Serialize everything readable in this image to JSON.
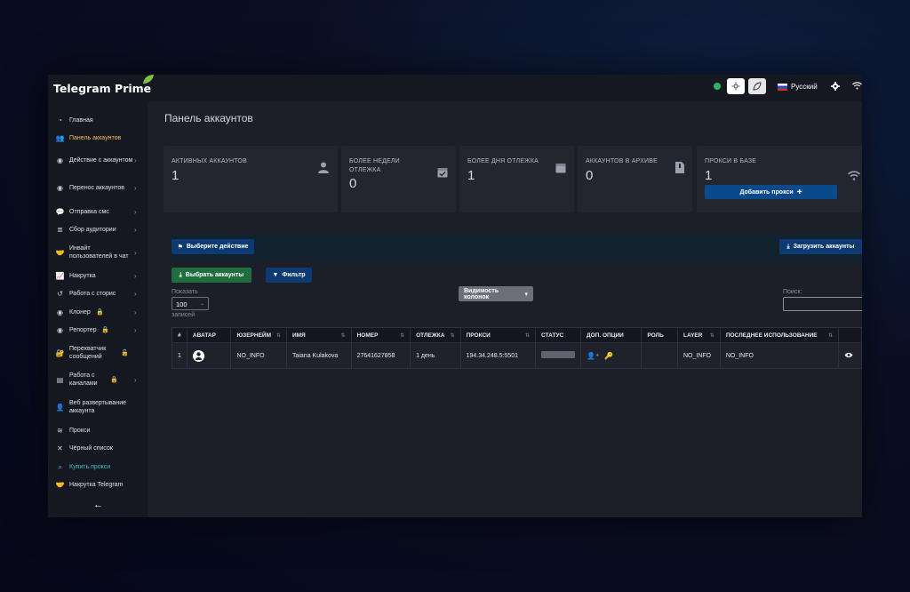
{
  "app": {
    "brand": "Telegram Prime",
    "language": "Русский"
  },
  "colors": {
    "accent_yellow": "#f0c14b",
    "accent_teal": "#39c0c8",
    "btn_blue": "#0c3b73",
    "btn_green": "#1f6e3f",
    "online_dot": "#28b463",
    "lock_red": "#e03b3b"
  },
  "sidebar": {
    "items": [
      {
        "label": "Главная",
        "icon": "dashboard-icon"
      },
      {
        "label": "Панель аккаунтов",
        "icon": "users-icon",
        "active": true
      },
      {
        "label": "Действие с аккаунтом",
        "icon": "user-circle-icon",
        "chevron": true
      },
      {
        "label": "Перенос аккаунтов",
        "icon": "user-circle-icon",
        "chevron": true
      },
      {
        "label": "Отправка смс",
        "icon": "comments-icon",
        "chevron": true
      },
      {
        "label": "Сбор аудитории",
        "icon": "database-icon",
        "chevron": true
      },
      {
        "label": "Инвайт пользователей в чат",
        "icon": "handshake-icon",
        "chevron": true
      },
      {
        "label": "Накрутка",
        "icon": "chart-icon",
        "chevron": true
      },
      {
        "label": "Работа с сторис",
        "icon": "history-icon",
        "chevron": true
      },
      {
        "label": "Клонер",
        "icon": "user-circle-icon",
        "chevron": true,
        "locked": true
      },
      {
        "label": "Репортер",
        "icon": "user-circle-icon",
        "chevron": true,
        "locked": true
      },
      {
        "label": "Перехватчик сообщений",
        "icon": "lock-icon",
        "unlocked": true
      },
      {
        "label": "Работа с каналами",
        "icon": "document-icon",
        "chevron": true,
        "locked": true
      },
      {
        "label": "Веб развертывание аккаунта",
        "icon": "user-icon"
      },
      {
        "label": "Прокси",
        "icon": "wifi-icon"
      },
      {
        "label": "Чёрный список",
        "icon": "close-icon"
      },
      {
        "label": "Купить прокси",
        "icon": "search-icon",
        "teal": true
      },
      {
        "label": "Накрутка Telegram",
        "icon": "handshake-icon"
      }
    ]
  },
  "main": {
    "title": "Панель аккаунтов",
    "stats": [
      {
        "label": "АКТИВНЫХ АККАУНТОВ",
        "value": "1",
        "icon": "user-icon"
      },
      {
        "label": "БОЛЕЕ НЕДЕЛИ ОТЛЕЖКА",
        "value": "0",
        "icon": "calendar-check-icon"
      },
      {
        "label": "БОЛЕЕ ДНЯ ОТЛЕЖКА",
        "value": "1",
        "icon": "calendar-icon"
      },
      {
        "label": "АККАУНТОВ В АРХИВЕ",
        "value": "0",
        "icon": "file-archive-icon"
      },
      {
        "label": "ПРОКСИ В БАЗЕ",
        "value": "1",
        "icon": "wifi-icon",
        "button": "Добавить прокси"
      }
    ],
    "actions": {
      "select_action": "Выберите действие",
      "upload_accounts": "Загрузить аккаунты",
      "select_accounts": "Выбрать аккаунты",
      "filter": "Фильтр",
      "column_visibility": "Видимость колонок"
    },
    "table_controls": {
      "show_label": "Показать",
      "entries_value": "100",
      "entries_label": "записей",
      "search_label": "Поиск:"
    },
    "table": {
      "columns": [
        "#",
        "АВАТАР",
        "ЮЗЕРНЕЙМ",
        "ИМЯ",
        "НОМЕР",
        "ОТЛЕЖКА",
        "ПРОКСИ",
        "СТАТУС",
        "ДОП. ОПЦИИ",
        "РОЛЬ",
        "LAYER",
        "ПОСЛЕДНЕЕ ИСПОЛЬЗОВАНИЕ",
        ""
      ],
      "rows": [
        {
          "index": "1",
          "username": "NO_INFO",
          "name": "Taiana Kulakova",
          "phone": "27641627858",
          "rest": "1 день",
          "proxy": "194.34.248.5:5501",
          "role": "",
          "layer": "NO_INFO",
          "last_used": "NO_INFO"
        }
      ]
    }
  }
}
